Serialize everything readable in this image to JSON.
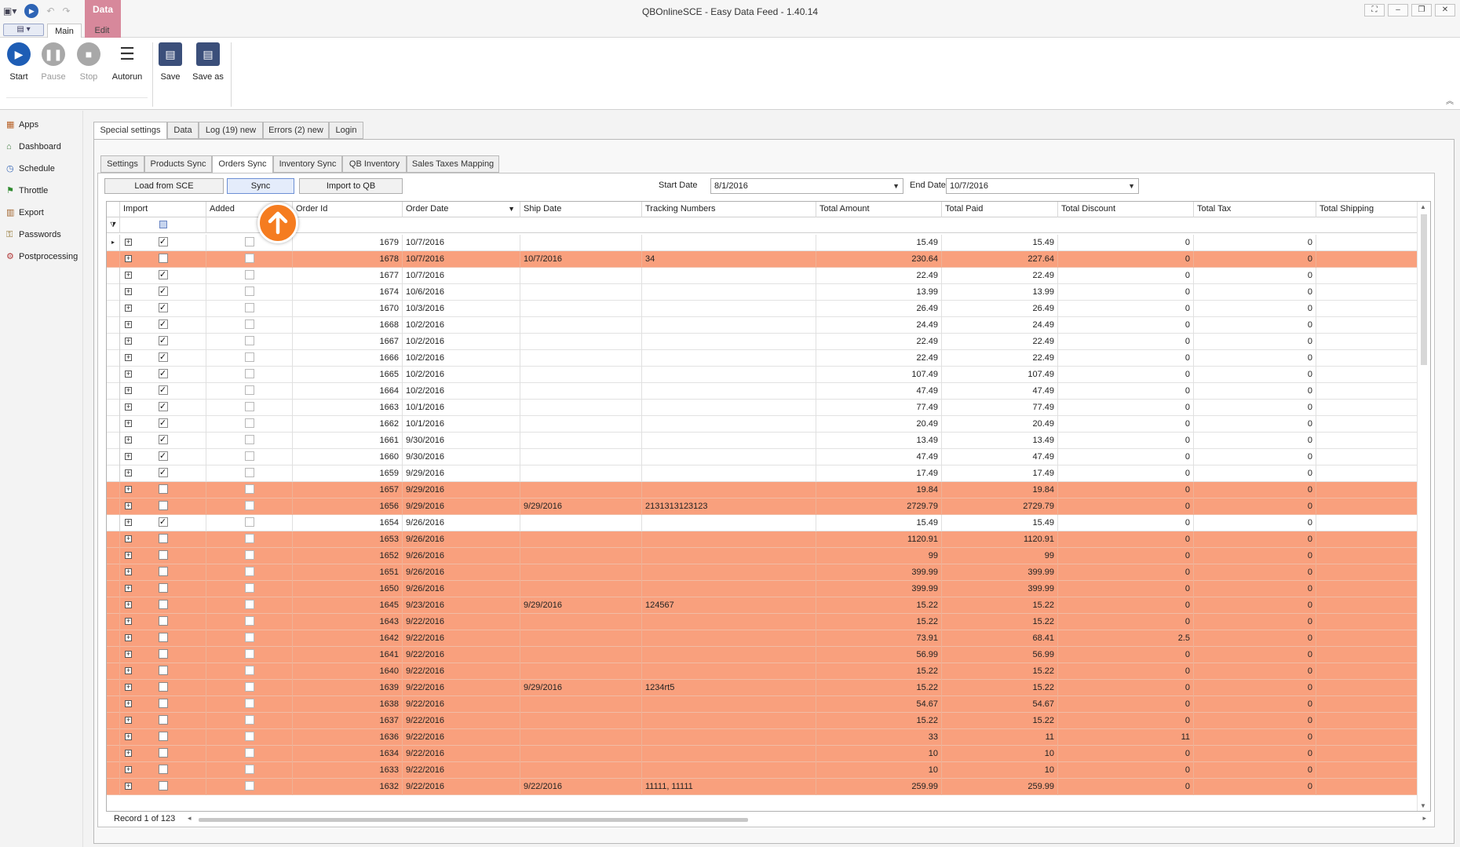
{
  "window": {
    "title": "QBOnlineSCE - Easy Data Feed - 1.40.14",
    "context_tab": "Data",
    "ribbon_tabs": [
      "Main",
      "Edit"
    ]
  },
  "ribbon": {
    "buttons": [
      {
        "label": "Start",
        "icon": "play-icon",
        "enabled": true
      },
      {
        "label": "Pause",
        "icon": "pause-icon",
        "enabled": false
      },
      {
        "label": "Stop",
        "icon": "stop-icon",
        "enabled": false
      },
      {
        "label": "Autorun",
        "icon": "autorun-icon",
        "enabled": true
      },
      {
        "label": "Save",
        "icon": "save-icon",
        "enabled": true
      },
      {
        "label": "Save as",
        "icon": "save-as-icon",
        "enabled": true
      }
    ]
  },
  "sidebar": {
    "items": [
      {
        "label": "Apps",
        "icon": "apps-icon"
      },
      {
        "label": "Dashboard",
        "icon": "dashboard-icon"
      },
      {
        "label": "Schedule",
        "icon": "schedule-icon"
      },
      {
        "label": "Throttle",
        "icon": "flag-icon"
      },
      {
        "label": "Export",
        "icon": "export-icon"
      },
      {
        "label": "Passwords",
        "icon": "passwords-icon"
      },
      {
        "label": "Postprocessing",
        "icon": "postprocessing-icon"
      }
    ]
  },
  "top_tabs": [
    "Special settings",
    "Data",
    "Log (19) new",
    "Errors (2) new",
    "Login"
  ],
  "sub_tabs": [
    "Settings",
    "Products Sync",
    "Orders Sync",
    "Inventory Sync",
    "QB Inventory",
    "Sales Taxes Mapping"
  ],
  "toolbar": {
    "load_label": "Load from SCE",
    "sync_label": "Sync",
    "import_label": "Import to QB",
    "start_date_label": "Start Date",
    "start_date": "8/1/2016",
    "end_date_label": "End Date",
    "end_date": "10/7/2016"
  },
  "grid": {
    "columns": [
      "Import",
      "Added",
      "Order Id",
      "Order Date",
      "Ship Date",
      "Tracking Numbers",
      "Total Amount",
      "Total Paid",
      "Total Discount",
      "Total Tax",
      "Total Shipping"
    ],
    "rows": [
      {
        "imp": true,
        "id": "1679",
        "od": "10/7/2016",
        "sd": "",
        "tr": "",
        "amt": "15.49",
        "paid": "15.49",
        "disc": "0",
        "tax": "0",
        "err": false
      },
      {
        "imp": false,
        "id": "1678",
        "od": "10/7/2016",
        "sd": "10/7/2016",
        "tr": "34",
        "amt": "230.64",
        "paid": "227.64",
        "disc": "0",
        "tax": "0",
        "err": true
      },
      {
        "imp": true,
        "id": "1677",
        "od": "10/7/2016",
        "sd": "",
        "tr": "",
        "amt": "22.49",
        "paid": "22.49",
        "disc": "0",
        "tax": "0",
        "err": false
      },
      {
        "imp": true,
        "id": "1674",
        "od": "10/6/2016",
        "sd": "",
        "tr": "",
        "amt": "13.99",
        "paid": "13.99",
        "disc": "0",
        "tax": "0",
        "err": false
      },
      {
        "imp": true,
        "id": "1670",
        "od": "10/3/2016",
        "sd": "",
        "tr": "",
        "amt": "26.49",
        "paid": "26.49",
        "disc": "0",
        "tax": "0",
        "err": false
      },
      {
        "imp": true,
        "id": "1668",
        "od": "10/2/2016",
        "sd": "",
        "tr": "",
        "amt": "24.49",
        "paid": "24.49",
        "disc": "0",
        "tax": "0",
        "err": false
      },
      {
        "imp": true,
        "id": "1667",
        "od": "10/2/2016",
        "sd": "",
        "tr": "",
        "amt": "22.49",
        "paid": "22.49",
        "disc": "0",
        "tax": "0",
        "err": false
      },
      {
        "imp": true,
        "id": "1666",
        "od": "10/2/2016",
        "sd": "",
        "tr": "",
        "amt": "22.49",
        "paid": "22.49",
        "disc": "0",
        "tax": "0",
        "err": false
      },
      {
        "imp": true,
        "id": "1665",
        "od": "10/2/2016",
        "sd": "",
        "tr": "",
        "amt": "107.49",
        "paid": "107.49",
        "disc": "0",
        "tax": "0",
        "err": false
      },
      {
        "imp": true,
        "id": "1664",
        "od": "10/2/2016",
        "sd": "",
        "tr": "",
        "amt": "47.49",
        "paid": "47.49",
        "disc": "0",
        "tax": "0",
        "err": false
      },
      {
        "imp": true,
        "id": "1663",
        "od": "10/1/2016",
        "sd": "",
        "tr": "",
        "amt": "77.49",
        "paid": "77.49",
        "disc": "0",
        "tax": "0",
        "err": false
      },
      {
        "imp": true,
        "id": "1662",
        "od": "10/1/2016",
        "sd": "",
        "tr": "",
        "amt": "20.49",
        "paid": "20.49",
        "disc": "0",
        "tax": "0",
        "err": false
      },
      {
        "imp": true,
        "id": "1661",
        "od": "9/30/2016",
        "sd": "",
        "tr": "",
        "amt": "13.49",
        "paid": "13.49",
        "disc": "0",
        "tax": "0",
        "err": false
      },
      {
        "imp": true,
        "id": "1660",
        "od": "9/30/2016",
        "sd": "",
        "tr": "",
        "amt": "47.49",
        "paid": "47.49",
        "disc": "0",
        "tax": "0",
        "err": false
      },
      {
        "imp": true,
        "id": "1659",
        "od": "9/29/2016",
        "sd": "",
        "tr": "",
        "amt": "17.49",
        "paid": "17.49",
        "disc": "0",
        "tax": "0",
        "err": false
      },
      {
        "imp": false,
        "id": "1657",
        "od": "9/29/2016",
        "sd": "",
        "tr": "",
        "amt": "19.84",
        "paid": "19.84",
        "disc": "0",
        "tax": "0",
        "err": true
      },
      {
        "imp": false,
        "id": "1656",
        "od": "9/29/2016",
        "sd": "9/29/2016",
        "tr": "2131313123123",
        "amt": "2729.79",
        "paid": "2729.79",
        "disc": "0",
        "tax": "0",
        "err": true
      },
      {
        "imp": true,
        "id": "1654",
        "od": "9/26/2016",
        "sd": "",
        "tr": "",
        "amt": "15.49",
        "paid": "15.49",
        "disc": "0",
        "tax": "0",
        "err": false
      },
      {
        "imp": false,
        "id": "1653",
        "od": "9/26/2016",
        "sd": "",
        "tr": "",
        "amt": "1120.91",
        "paid": "1120.91",
        "disc": "0",
        "tax": "0",
        "err": true
      },
      {
        "imp": false,
        "id": "1652",
        "od": "9/26/2016",
        "sd": "",
        "tr": "",
        "amt": "99",
        "paid": "99",
        "disc": "0",
        "tax": "0",
        "err": true
      },
      {
        "imp": false,
        "id": "1651",
        "od": "9/26/2016",
        "sd": "",
        "tr": "",
        "amt": "399.99",
        "paid": "399.99",
        "disc": "0",
        "tax": "0",
        "err": true
      },
      {
        "imp": false,
        "id": "1650",
        "od": "9/26/2016",
        "sd": "",
        "tr": "",
        "amt": "399.99",
        "paid": "399.99",
        "disc": "0",
        "tax": "0",
        "err": true
      },
      {
        "imp": false,
        "id": "1645",
        "od": "9/23/2016",
        "sd": "9/29/2016",
        "tr": "124567",
        "amt": "15.22",
        "paid": "15.22",
        "disc": "0",
        "tax": "0",
        "err": true
      },
      {
        "imp": false,
        "id": "1643",
        "od": "9/22/2016",
        "sd": "",
        "tr": "",
        "amt": "15.22",
        "paid": "15.22",
        "disc": "0",
        "tax": "0",
        "err": true
      },
      {
        "imp": false,
        "id": "1642",
        "od": "9/22/2016",
        "sd": "",
        "tr": "",
        "amt": "73.91",
        "paid": "68.41",
        "disc": "2.5",
        "tax": "0",
        "err": true
      },
      {
        "imp": false,
        "id": "1641",
        "od": "9/22/2016",
        "sd": "",
        "tr": "",
        "amt": "56.99",
        "paid": "56.99",
        "disc": "0",
        "tax": "0",
        "err": true
      },
      {
        "imp": false,
        "id": "1640",
        "od": "9/22/2016",
        "sd": "",
        "tr": "",
        "amt": "15.22",
        "paid": "15.22",
        "disc": "0",
        "tax": "0",
        "err": true
      },
      {
        "imp": false,
        "id": "1639",
        "od": "9/22/2016",
        "sd": "9/29/2016",
        "tr": "1234rt5",
        "amt": "15.22",
        "paid": "15.22",
        "disc": "0",
        "tax": "0",
        "err": true
      },
      {
        "imp": false,
        "id": "1638",
        "od": "9/22/2016",
        "sd": "",
        "tr": "",
        "amt": "54.67",
        "paid": "54.67",
        "disc": "0",
        "tax": "0",
        "err": true
      },
      {
        "imp": false,
        "id": "1637",
        "od": "9/22/2016",
        "sd": "",
        "tr": "",
        "amt": "15.22",
        "paid": "15.22",
        "disc": "0",
        "tax": "0",
        "err": true
      },
      {
        "imp": false,
        "id": "1636",
        "od": "9/22/2016",
        "sd": "",
        "tr": "",
        "amt": "33",
        "paid": "11",
        "disc": "11",
        "tax": "0",
        "err": true
      },
      {
        "imp": false,
        "id": "1634",
        "od": "9/22/2016",
        "sd": "",
        "tr": "",
        "amt": "10",
        "paid": "10",
        "disc": "0",
        "tax": "0",
        "err": true
      },
      {
        "imp": false,
        "id": "1633",
        "od": "9/22/2016",
        "sd": "",
        "tr": "",
        "amt": "10",
        "paid": "10",
        "disc": "0",
        "tax": "0",
        "err": true
      },
      {
        "imp": false,
        "id": "1632",
        "od": "9/22/2016",
        "sd": "9/22/2016",
        "tr": "11111, 11111",
        "amt": "259.99",
        "paid": "259.99",
        "disc": "0",
        "tax": "0",
        "err": true
      }
    ]
  },
  "footer": {
    "record": "Record 1 of 123"
  },
  "colors": {
    "error_row": "#f9a07d",
    "accent": "#1e5db5",
    "pointer": "#f57c20"
  }
}
